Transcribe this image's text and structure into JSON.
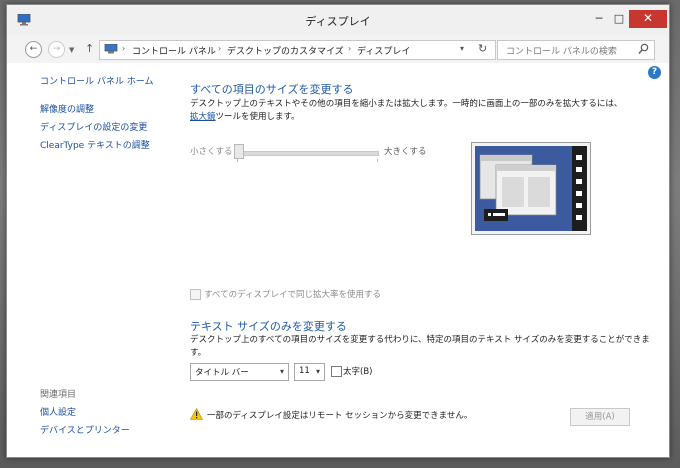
{
  "window": {
    "title": "ディスプレイ",
    "minimize_glyph": "─",
    "maximize_glyph": "□",
    "close_glyph": "✕"
  },
  "address": {
    "crumbs": [
      "コントロール パネル",
      "デスクトップのカスタマイズ",
      "ディスプレイ"
    ],
    "search_placeholder": "コントロール パネルの検索"
  },
  "help": {
    "glyph": "?"
  },
  "sidebar": {
    "home": "コントロール パネル ホーム",
    "items": [
      "解像度の調整",
      "ディスプレイの設定の変更",
      "ClearType テキストの調整"
    ],
    "see_also_title": "関連項目",
    "see_also": [
      "個人設定",
      "デバイスとプリンター"
    ]
  },
  "main": {
    "resize_title": "すべての項目のサイズを変更する",
    "resize_desc_1": "デスクトップ上のテキストやその他の項目を縮小または拡大します。一時的に画面上の一部のみを拡大するには、",
    "magnifier_link": "拡大鏡",
    "resize_desc_2": "ツールを使用します。",
    "slider_small": "小さくする",
    "slider_large": "大きくする",
    "same_scale_label": "すべてのディスプレイで同じ拡大率を使用する",
    "text_title": "テキスト サイズのみを変更する",
    "text_desc": "デスクトップ上のすべての項目のサイズを変更する代わりに、特定の項目のテキスト サイズのみを変更することができます。",
    "item_select": "タイトル バー",
    "size_select": "11",
    "bold_label": "太字(B)",
    "warning": "一部のディスプレイ設定はリモート セッションから変更できません。",
    "apply": "適用(A)"
  },
  "colors": {
    "link": "#1a4fa1",
    "heading": "#1e5aa8",
    "close_button": "#c7372f",
    "preview_blue": "#3c5a9e"
  }
}
